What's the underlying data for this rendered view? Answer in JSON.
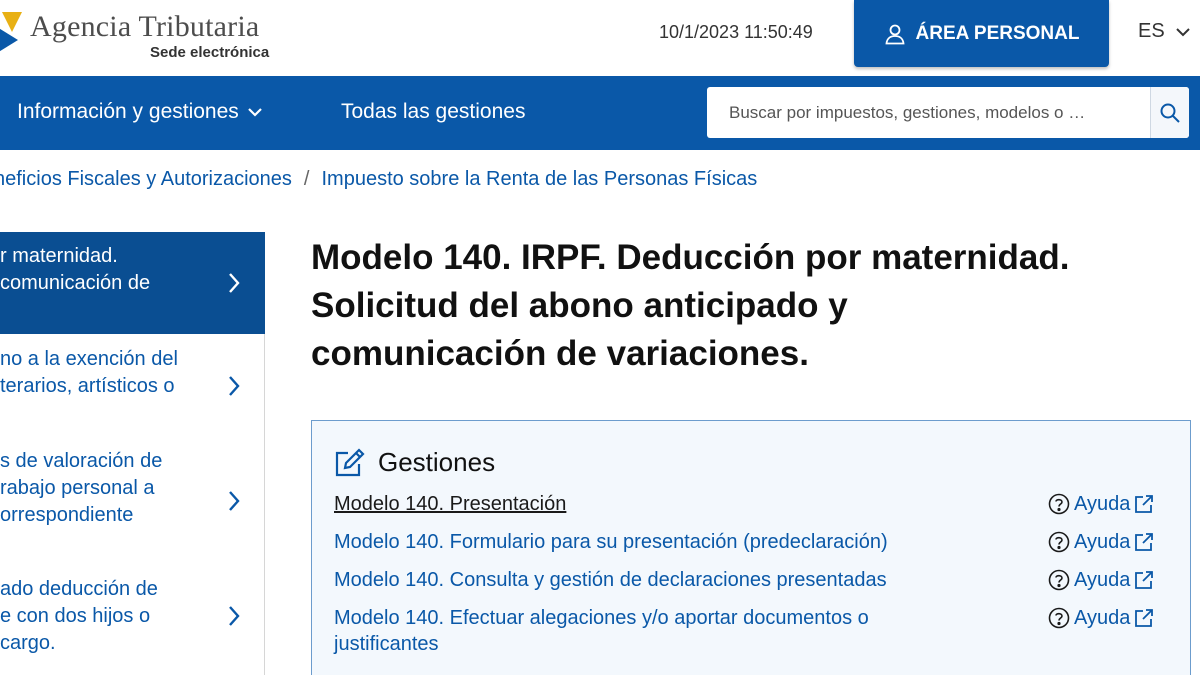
{
  "header": {
    "brand_title": "Agencia Tributaria",
    "brand_subtitle": "Sede electrónica",
    "datetime": "10/1/2023 11:50:49",
    "area_personal_label": "ÁREA PERSONAL",
    "language": "ES"
  },
  "nav": {
    "info_label": "Información y gestiones",
    "todas_label": "Todas las gestiones",
    "search_placeholder": "Buscar por impuestos, gestiones, modelos o …"
  },
  "breadcrumb": {
    "item1": "neficios Fiscales y Autorizaciones",
    "separator": "/",
    "item2": "Impuesto sobre la Renta de las Personas Físicas"
  },
  "sidebar": {
    "items": [
      {
        "lines": [
          "r maternidad.",
          "comunicación de"
        ]
      },
      {
        "lines": [
          "no a la exención del",
          "terarios, artísticos o"
        ]
      },
      {
        "lines": [
          "s de valoración de",
          "rabajo personal a",
          "orrespondiente"
        ]
      },
      {
        "lines": [
          "ado deducción de",
          "e con dos hijos o",
          " cargo."
        ]
      }
    ]
  },
  "main": {
    "title_lines": [
      "Modelo 140. IRPF. Deducción por maternidad.",
      "Solicitud del abono anticipado y",
      "comunicación de variaciones."
    ]
  },
  "gestiones": {
    "heading": "Gestiones",
    "help_label": "Ayuda",
    "rows": [
      {
        "lines": [
          "Modelo 140. Presentación"
        ]
      },
      {
        "lines": [
          "Modelo 140. Formulario para su presentación (predeclaración)"
        ]
      },
      {
        "lines": [
          "Modelo 140. Consulta y gestión de declaraciones presentadas"
        ]
      },
      {
        "lines": [
          "Modelo 140. Efectuar alegaciones y/o aportar documentos o",
          "justificantes"
        ]
      }
    ]
  },
  "colors": {
    "brand_blue": "#0a58a8",
    "sidebar_active": "#0a4e92",
    "box_bg": "#f3f8fd"
  }
}
